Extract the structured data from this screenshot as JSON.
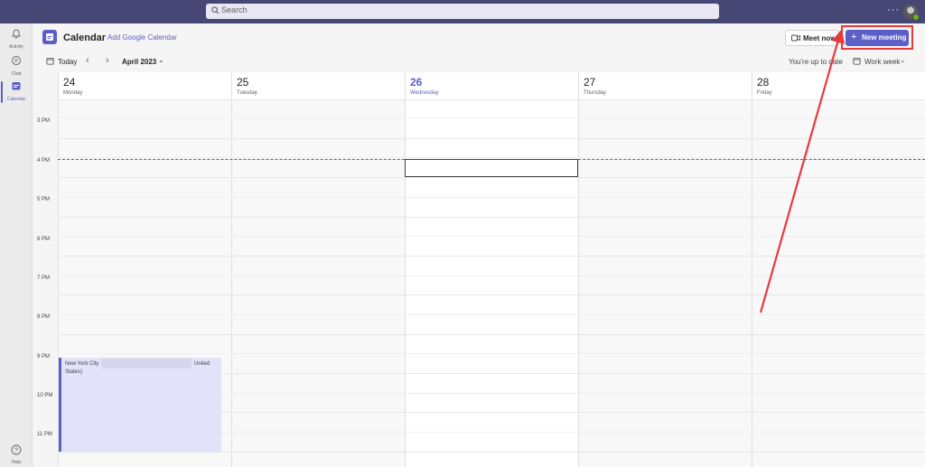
{
  "topbar": {
    "search_placeholder": "Search",
    "more_label": "···"
  },
  "rail": {
    "items": [
      {
        "label": "Activity",
        "icon": "bell-icon"
      },
      {
        "label": "Chat",
        "icon": "chat-icon"
      },
      {
        "label": "Calendar",
        "icon": "calendar-icon"
      }
    ],
    "help_label": "Help"
  },
  "header": {
    "title": "Calendar",
    "add_google": "Add Google Calendar",
    "meet_now": "Meet now",
    "new_meeting": "New meeting"
  },
  "toolbar": {
    "today": "Today",
    "month": "April 2023",
    "up_to_date": "You're up to date",
    "view": "Work week"
  },
  "days": [
    {
      "num": "24",
      "name": "Monday"
    },
    {
      "num": "25",
      "name": "Tuesday"
    },
    {
      "num": "26",
      "name": "Wednesday"
    },
    {
      "num": "27",
      "name": "Thursday"
    },
    {
      "num": "28",
      "name": "Friday"
    }
  ],
  "hours": [
    "3 PM",
    "4 PM",
    "5 PM",
    "6 PM",
    "7 PM",
    "8 PM",
    "9 PM",
    "10 PM",
    "11 PM"
  ],
  "event": {
    "line1a": "New York City",
    "line1b": "United",
    "line2": "States)"
  },
  "colors": {
    "accent": "#5b5fc7",
    "topbar": "#464775",
    "annotation": "#e8393a"
  }
}
